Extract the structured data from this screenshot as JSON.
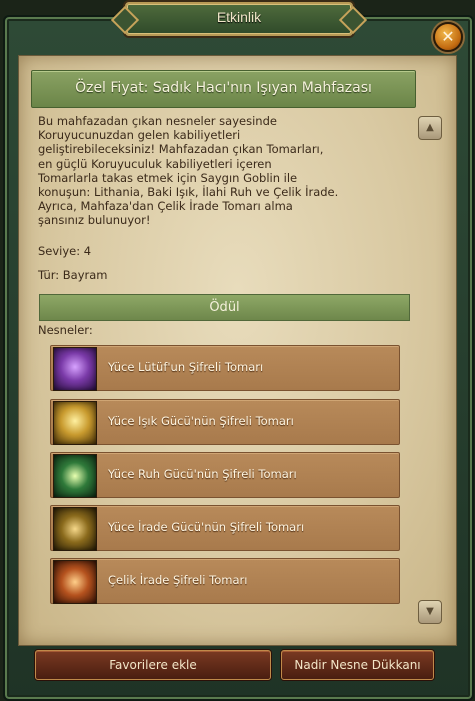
{
  "window": {
    "title": "Etkinlik",
    "close_label": "✕"
  },
  "event": {
    "header": "Özel Fiyat: Sadık Hacı'nın Işıyan Mahfazası",
    "description_lines": [
      "Bu mahfazadan çıkan nesneler sayesinde",
      "Koruyucunuzdan gelen kabiliyetleri",
      "geliştirebileceksiniz! Mahfazadan çıkan Tomarları,",
      "en güçlü Koruyuculuk kabiliyetleri içeren",
      "Tomarlarla takas etmek için Saygın Goblin ile",
      "konuşun: Lithania, Baki Işık, İlahi Ruh ve Çelik İrade.",
      "Ayrıca, Mahfaza'dan Çelik İrade Tomarı alma",
      "şansınız bulunuyor!"
    ],
    "level": "Seviye: 4",
    "type": "Tür: Bayram"
  },
  "reward": {
    "title": "Ödül",
    "items_label": "Nesneler:",
    "items": [
      {
        "label": "Yüce Lütüf'un Şifreli Tomarı",
        "icon": "purple-rune-icon",
        "color": "#7a3aa8"
      },
      {
        "label": "Yüce Işık Gücü'nün Şifreli Tomarı",
        "icon": "golden-statue-icon",
        "color": "#c89a2e"
      },
      {
        "label": "Yüce Ruh Gücü'nün Şifreli Tomarı",
        "icon": "green-sun-icon",
        "color": "#2f7a3a"
      },
      {
        "label": "Yüce İrade Gücü'nün Şifreli Tomarı",
        "icon": "fist-gold-icon",
        "color": "#8a6a1c"
      },
      {
        "label": "Çelik İrade Şifreli Tomarı",
        "icon": "fist-orange-icon",
        "color": "#b5521e"
      }
    ]
  },
  "buttons": {
    "favorite": "Favorilere ekle",
    "shop": "Nadir Nesne Dükkanı"
  },
  "scroll": {
    "up": "▲",
    "down": "▼"
  }
}
